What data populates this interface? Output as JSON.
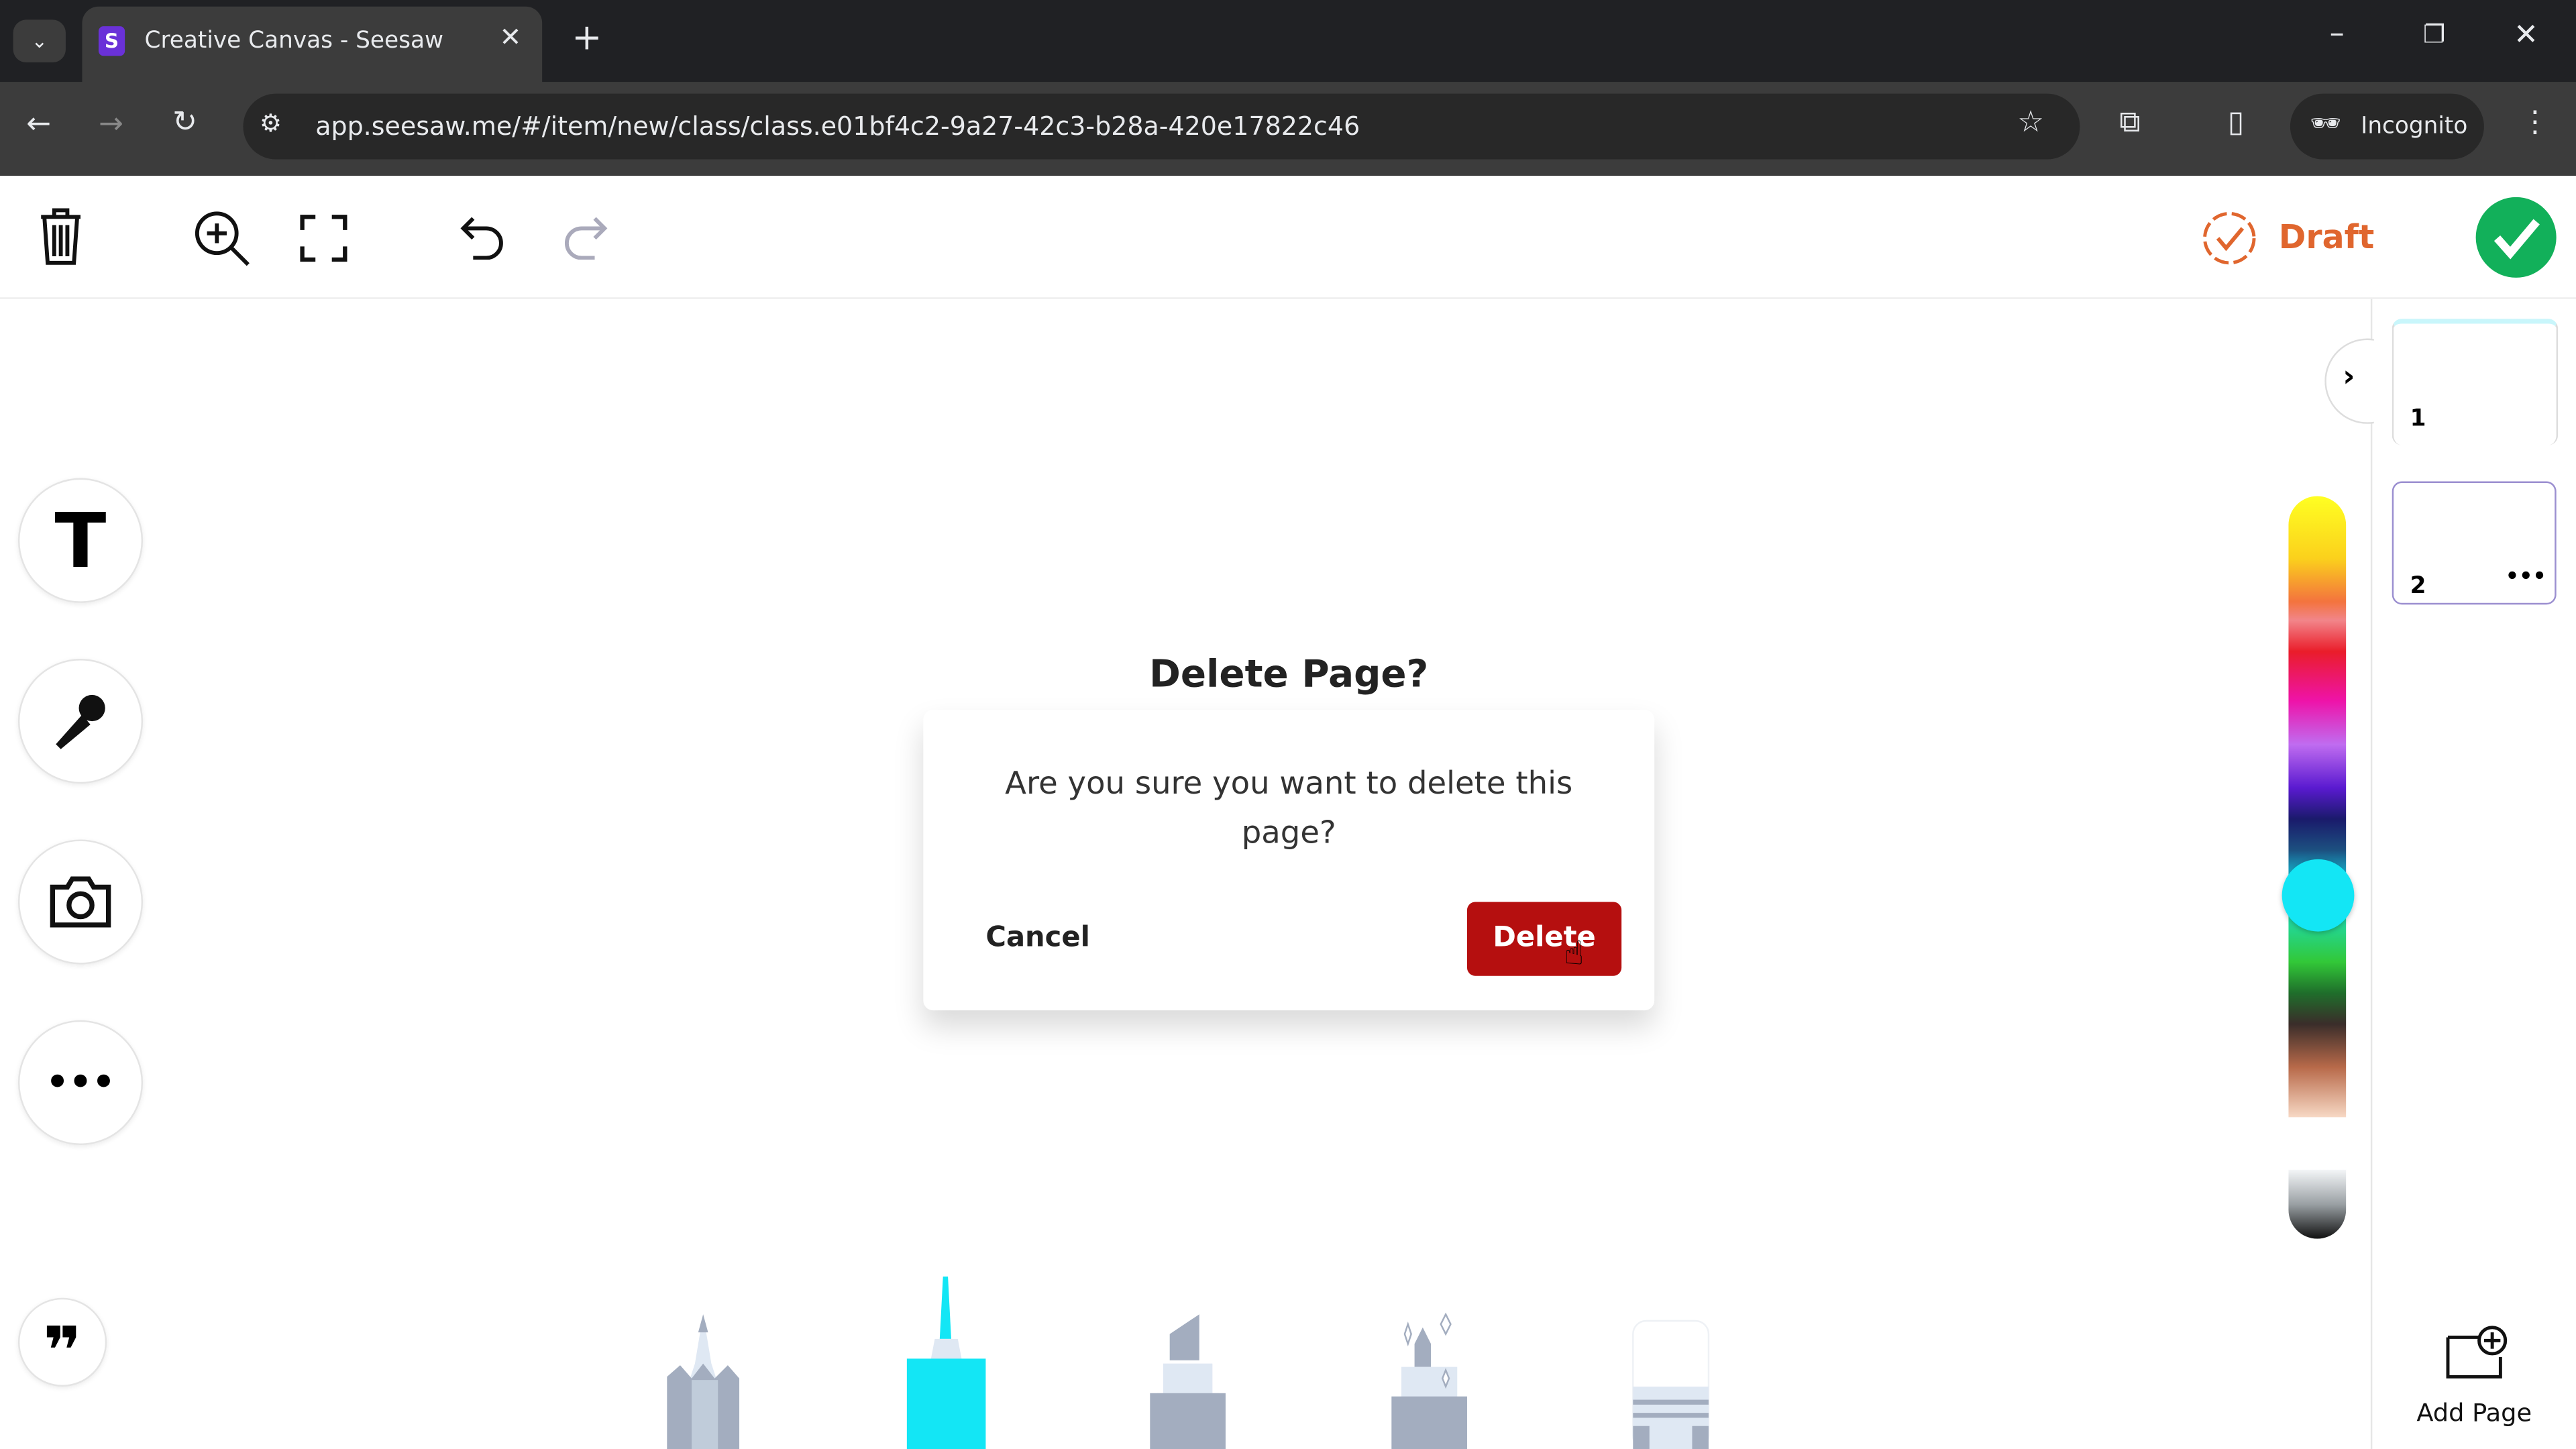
{
  "browser": {
    "tab_title": "Creative Canvas - Seesaw",
    "url": "app.seesaw.me/#/item/new/class/class.e01bf4c2-9a27-42c3-b28a-420e17822c46",
    "profile_label": "Incognito"
  },
  "app_header": {
    "status_label": "Draft",
    "status_color": "#e0662e",
    "done_color": "#12b05a"
  },
  "left_tools": [
    "text-tool",
    "microphone-tool",
    "camera-tool",
    "more-tool",
    "quote-tool"
  ],
  "tool_glyphs": {
    "text": "T",
    "more": "•••",
    "quote": "❞"
  },
  "dialog": {
    "title": "Delete Page?",
    "message": "Are you sure you want to delete this page?",
    "cancel_label": "Cancel",
    "delete_label": "Delete",
    "delete_color": "#b50f0f"
  },
  "pages": {
    "items": [
      {
        "number": "1"
      },
      {
        "number": "2",
        "selected": true
      }
    ],
    "more_glyph": "•••",
    "add_page_label": "Add Page"
  },
  "color_picker": {
    "selected_color": "#13e6f5"
  },
  "drawing_tools": [
    "pencil",
    "marker",
    "highlighter",
    "glitter-pen",
    "eraser"
  ],
  "selected_drawing_tool": "marker"
}
